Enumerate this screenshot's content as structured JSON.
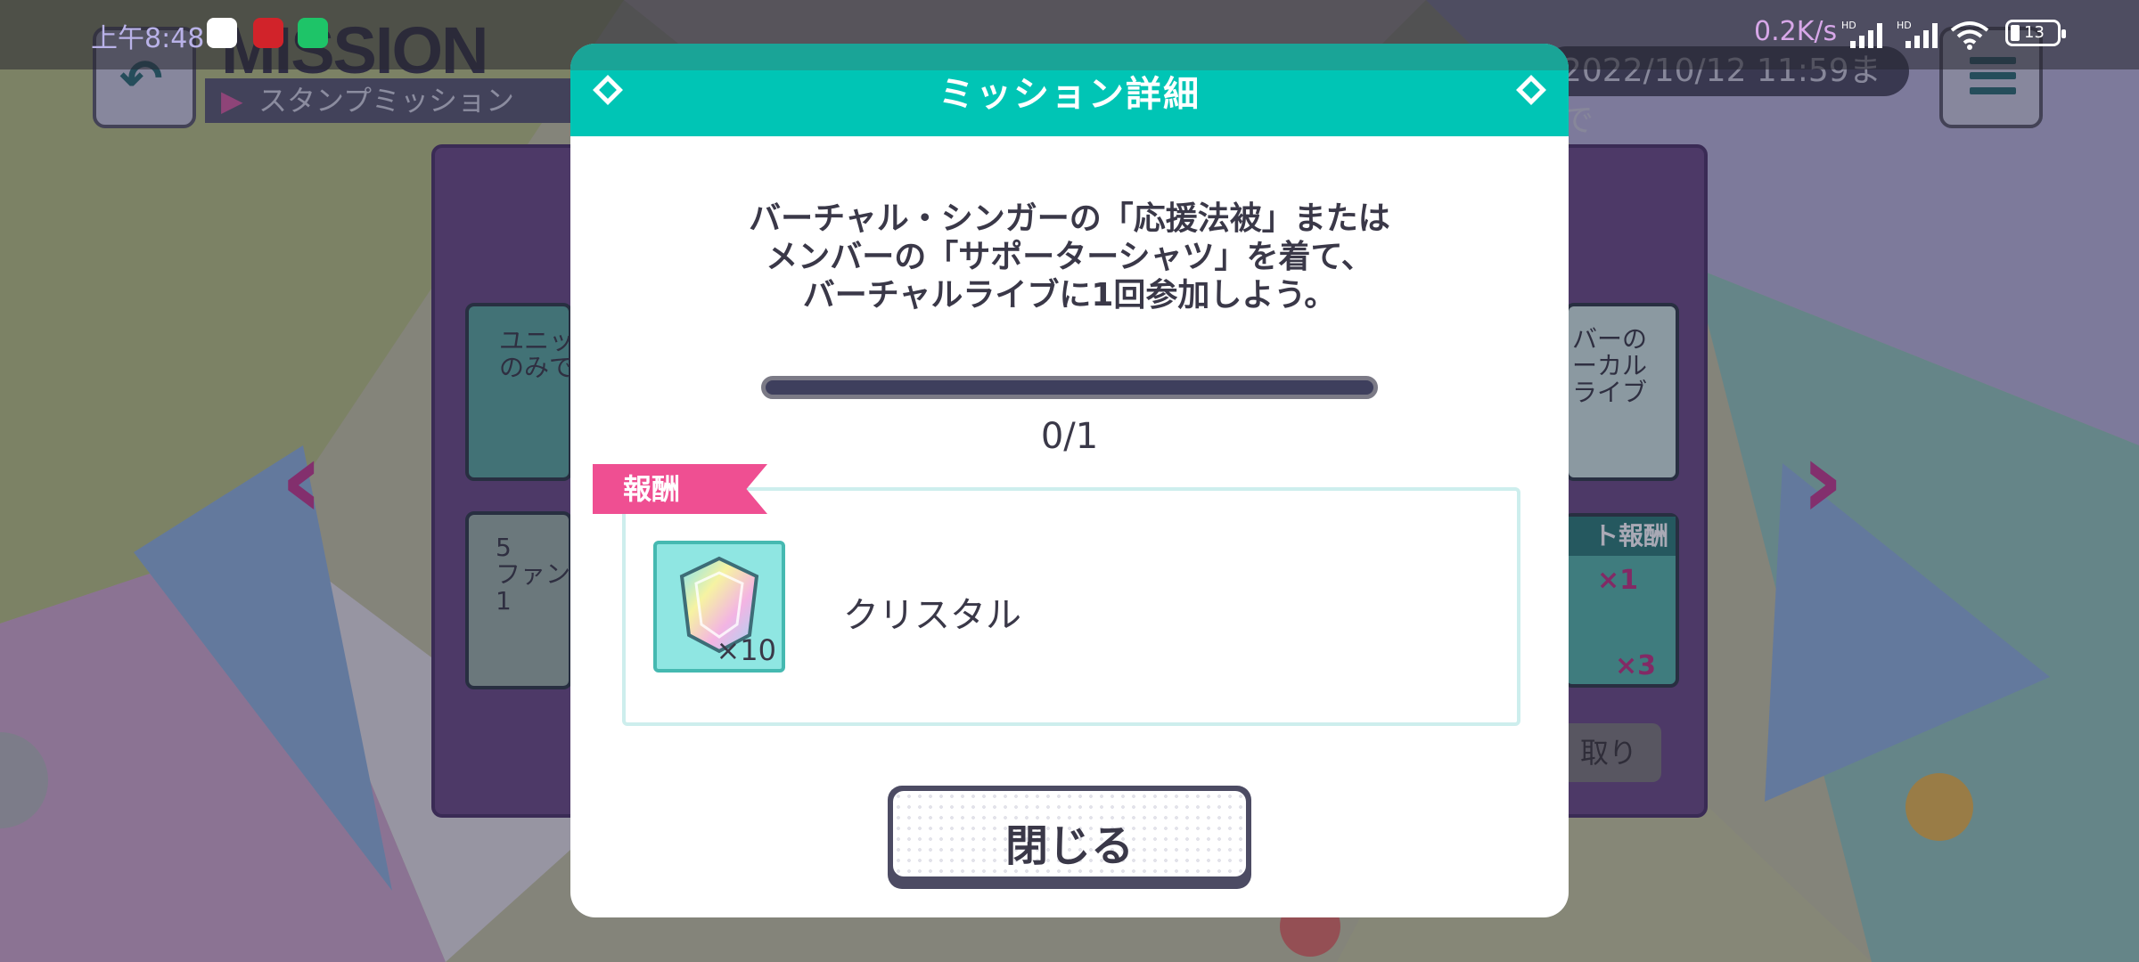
{
  "status_bar": {
    "time": "上午8:48",
    "net_speed": "0.2K/s",
    "signal_1_label": "HD",
    "signal_2_label": "HD",
    "battery_text": "13"
  },
  "header": {
    "title": "MISSION",
    "subtitle": "スタンプミッション",
    "deadline": "2022/10/12 11:59まで"
  },
  "board": {
    "left_card_1": "ユニッ\nのみで",
    "left_card_2": "5\nファン\n1",
    "right_card_1": "バーの\nーカル\nライブ",
    "right_reward_header": "ト報酬",
    "right_reward_qty_1": "×1",
    "right_reward_qty_2": "×3",
    "receive_button": "取り"
  },
  "modal": {
    "title": "ミッション詳細",
    "description_line1": "バーチャル・シンガーの「応援法被」または",
    "description_line2": "メンバーの「サポーターシャツ」を着て、",
    "description_line3": "バーチャルライブに1回参加しよう。",
    "progress_current": 0,
    "progress_total": 1,
    "progress_text": "0/1",
    "reward_tag": "報酬",
    "reward_item_name": "クリスタル",
    "reward_item_qty": "×10",
    "close_label": "閉じる"
  },
  "colors": {
    "accent_teal": "#00c5b5",
    "reward_tag_pink": "#ef4f92",
    "text_dark": "#3a3848"
  },
  "icons": {
    "back": "back-arrow-icon",
    "menu": "hamburger-menu-icon",
    "reward_item": "crystal-icon"
  }
}
